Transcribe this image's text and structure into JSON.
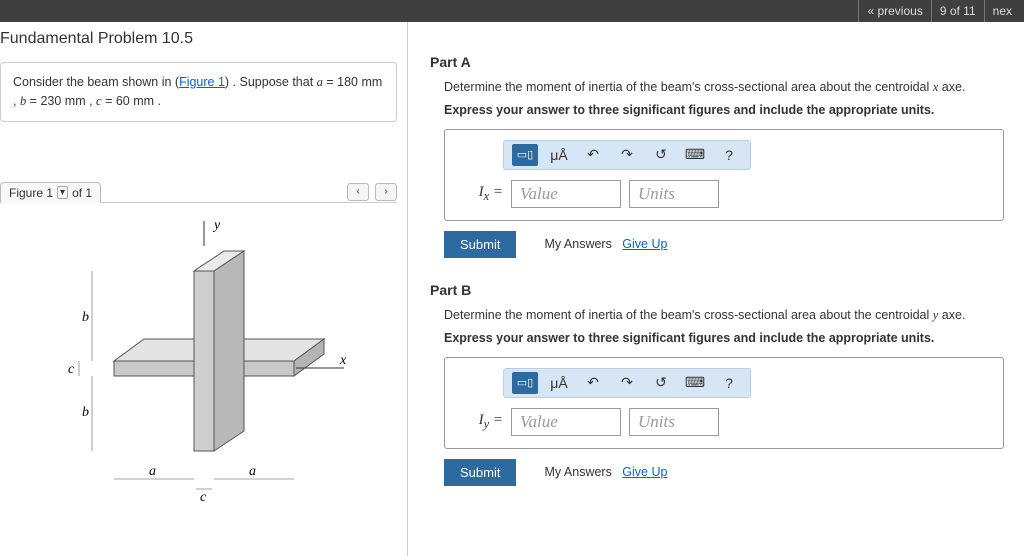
{
  "topbar": {
    "previous": "« previous",
    "count": "9 of 11",
    "next": "nex"
  },
  "problem": {
    "title": "Fundamental Problem 10.5",
    "desc_pre": "Consider the beam shown in (",
    "figure_link": "Figure 1",
    "desc_post": ") . Suppose that ",
    "a_var": "a",
    "a_val": " = 180  mm , ",
    "b_var": "b",
    "b_val": " = 230  mm , ",
    "c_var": "c",
    "c_val": " = 60  mm ."
  },
  "figure": {
    "tab_label": "Figure 1",
    "count": "of 1",
    "labels": {
      "x": "x",
      "y": "y",
      "a": "a",
      "b": "b",
      "c": "c"
    }
  },
  "parts": [
    {
      "title": "Part A",
      "desc_pre": "Determine the moment of inertia of the beam's cross-sectional area about the centroidal ",
      "axis_var": "x",
      "desc_post": " axe.",
      "instruction": "Express your answer to three significant figures and include the appropriate units.",
      "symbol_html": "I<sub>x</sub> =",
      "value_ph": "Value",
      "units_ph": "Units",
      "toolbar_mu": "μÅ",
      "submit": "Submit",
      "my_answers": "My Answers",
      "give_up": "Give Up"
    },
    {
      "title": "Part B",
      "desc_pre": "Determine the moment of inertia of the beam's cross-sectional area about the centroidal ",
      "axis_var": "y",
      "desc_post": " axe.",
      "instruction": "Express your answer to three significant figures and include the appropriate units.",
      "symbol_html": "I<sub>y</sub> =",
      "value_ph": "Value",
      "units_ph": "Units",
      "toolbar_mu": "μÅ",
      "submit": "Submit",
      "my_answers": "My Answers",
      "give_up": "Give Up"
    }
  ]
}
